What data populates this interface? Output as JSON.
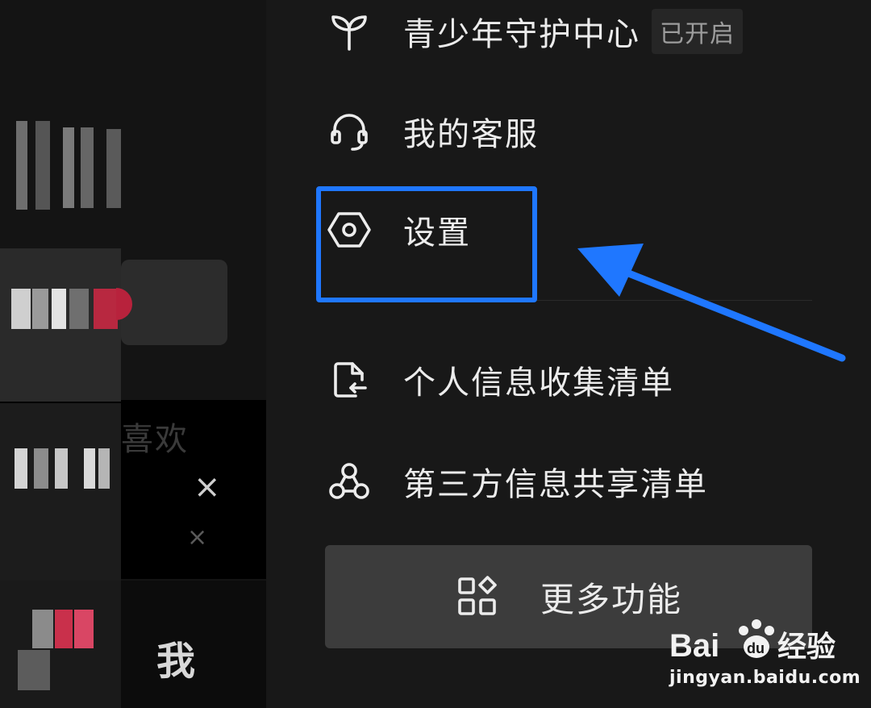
{
  "drawer": {
    "items": [
      {
        "label": "青少年守护中心",
        "icon": "sprout-icon",
        "badge": "已开启"
      },
      {
        "label": "我的客服",
        "icon": "headset-icon"
      },
      {
        "label": "设置",
        "icon": "hexagon-gear-icon"
      },
      {
        "label": "个人信息收集清单",
        "icon": "document-arrow-icon"
      },
      {
        "label": "第三方信息共享清单",
        "icon": "share-circles-icon"
      }
    ],
    "more_button": {
      "label": "更多功能",
      "icon": "grid-apps-icon"
    }
  },
  "background": {
    "like_text": "喜欢",
    "close_glyph": "×",
    "tab_me_label": "我"
  },
  "annotation": {
    "color": "#1f77ff"
  },
  "watermark": {
    "logo_text": "Baidu经验",
    "url": "jingyan.baidu.com"
  }
}
